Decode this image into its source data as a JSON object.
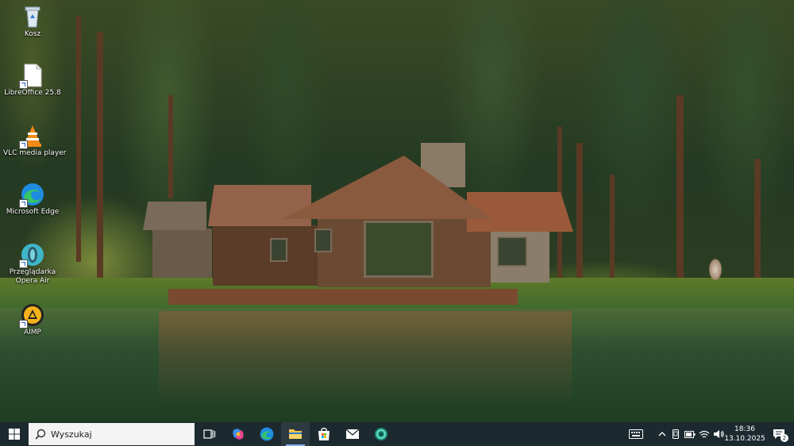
{
  "desktop": {
    "icons": [
      {
        "label": "Kosz",
        "icon": "recycle-bin-icon"
      },
      {
        "label": "LibreOffice 25.8",
        "icon": "libreoffice-icon"
      },
      {
        "label": "VLC media player",
        "icon": "vlc-icon"
      },
      {
        "label": "Microsoft Edge",
        "icon": "edge-icon"
      },
      {
        "label": "Przeglądarka Opera Air",
        "icon": "opera-air-icon"
      },
      {
        "label": "AIMP",
        "icon": "aimp-icon"
      }
    ]
  },
  "taskbar": {
    "search_placeholder": "Wyszukaj",
    "pinned": [
      "task-view-icon",
      "copilot-icon",
      "edge-icon",
      "file-explorer-icon",
      "microsoft-store-icon",
      "mail-icon",
      "app-icon"
    ],
    "active_app": "file-explorer-icon",
    "clock": {
      "time": "18:36",
      "date": "13.10.2025"
    },
    "notification_count": "2",
    "colors": {
      "taskbar_bg": "#1c2a30",
      "active_indicator": "#7fb2f0"
    }
  }
}
